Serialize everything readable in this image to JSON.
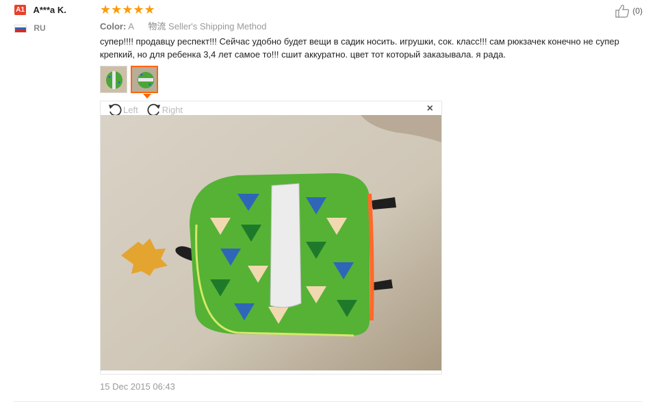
{
  "user": {
    "level": "A1",
    "name": "A***a K.",
    "country": "RU"
  },
  "rating": {
    "stars": 5,
    "max": 5,
    "glyph": "★★★★★"
  },
  "meta": {
    "color_label": "Color:",
    "color_value": "A",
    "shipping_label": "物流",
    "shipping_value": "Seller's Shipping Method"
  },
  "helpful": {
    "count": "(0)"
  },
  "review_text": "супер!!!! продавцу респект!!! Сейчас удобно будет вещи в садик носить. игрушки, сок. класс!!! сам рюкзачек конечно не супер крепкий, но для ребенка 3,4 лет самое то!!! сшит аккуратно. цвет тот который заказывала. я рада.",
  "viewer": {
    "rotate_left": "Left",
    "rotate_right": "Right",
    "close": "×"
  },
  "date": "15 Dec 2015 06:43",
  "colors": {
    "accent": "#ff6600",
    "star": "#ff9a00",
    "badge": "#e8412c"
  }
}
